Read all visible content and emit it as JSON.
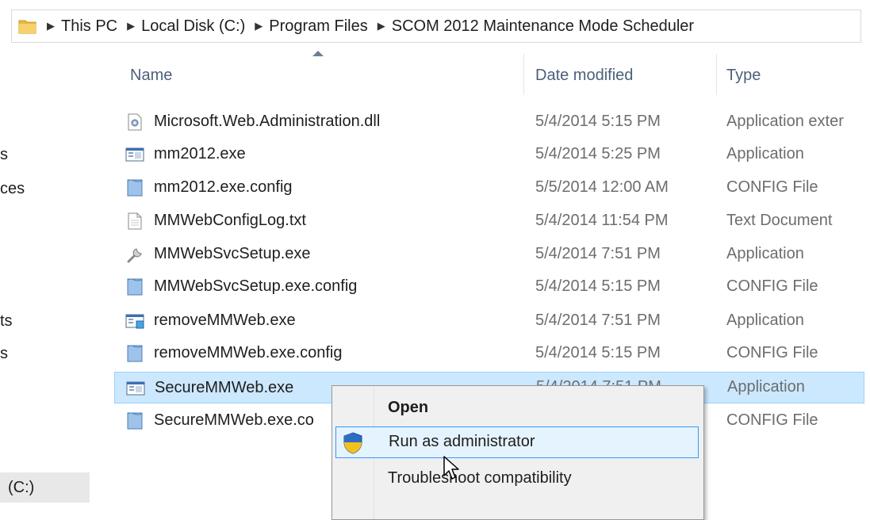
{
  "address_bar": {
    "crumbs": [
      "This PC",
      "Local Disk (C:)",
      "Program Files",
      "SCOM 2012 Maintenance Mode Scheduler"
    ]
  },
  "nav_pane": {
    "fragments": [
      "s",
      "ces",
      "ts",
      "s"
    ],
    "drive_label": "(C:)"
  },
  "columns": {
    "name": "Name",
    "date_modified": "Date modified",
    "type": "Type"
  },
  "files": [
    {
      "name": "Microsoft.Web.Administration.dll",
      "date": "5/4/2014 5:15 PM",
      "type": "Application exter",
      "icon": "dll-icon"
    },
    {
      "name": "mm2012.exe",
      "date": "5/4/2014 5:25 PM",
      "type": "Application",
      "icon": "exe-icon"
    },
    {
      "name": "mm2012.exe.config",
      "date": "5/5/2014 12:00 AM",
      "type": "CONFIG File",
      "icon": "config-file-icon"
    },
    {
      "name": "MMWebConfigLog.txt",
      "date": "5/4/2014 11:54 PM",
      "type": "Text Document",
      "icon": "text-file-icon"
    },
    {
      "name": "MMWebSvcSetup.exe",
      "date": "5/4/2014 7:51 PM",
      "type": "Application",
      "icon": "setup-wrench-icon"
    },
    {
      "name": "MMWebSvcSetup.exe.config",
      "date": "5/4/2014 5:15 PM",
      "type": "CONFIG File",
      "icon": "config-file-icon"
    },
    {
      "name": "removeMMWeb.exe",
      "date": "5/4/2014 7:51 PM",
      "type": "Application",
      "icon": "exe-icon"
    },
    {
      "name": "removeMMWeb.exe.config",
      "date": "5/4/2014 5:15 PM",
      "type": "CONFIG File",
      "icon": "config-file-icon"
    },
    {
      "name": "SecureMMWeb.exe",
      "date": "5/4/2014 7:51 PM",
      "type": "Application",
      "icon": "exe-icon",
      "selected": true
    },
    {
      "name": "SecureMMWeb.exe.co",
      "date": "",
      "type": "CONFIG File",
      "icon": "config-file-icon"
    }
  ],
  "context_menu": {
    "items": [
      {
        "label": "Open",
        "bold": true
      },
      {
        "label": "Run as administrator",
        "icon": "uac-shield-icon",
        "highlighted": true
      },
      {
        "label": "Troubleshoot compatibility"
      }
    ]
  },
  "colors": {
    "selection_bg": "#cce8ff",
    "selection_border": "#99d1ff",
    "menu_highlight_bg": "#e5f3ff",
    "menu_highlight_border": "#3399ff",
    "header_text": "#4c607a"
  }
}
